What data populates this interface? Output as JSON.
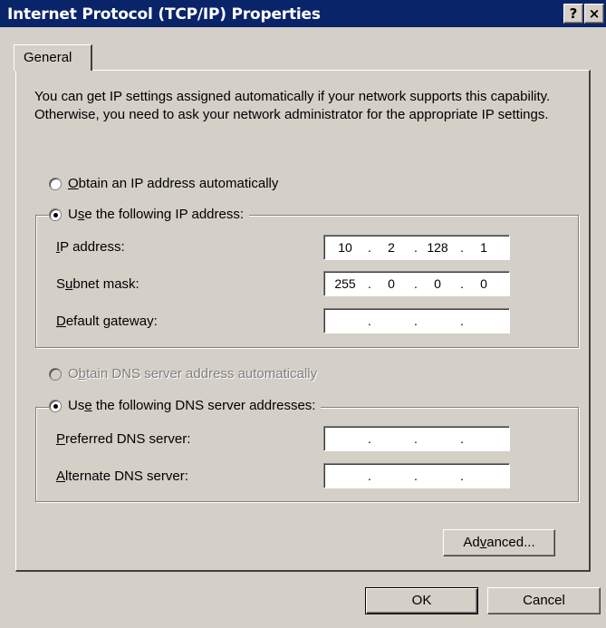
{
  "window": {
    "title": "Internet Protocol (TCP/IP) Properties",
    "help_label": "?",
    "close_label": "×"
  },
  "tab": {
    "label": "General"
  },
  "intro": "You can get IP settings assigned automatically if your network supports this capability. Otherwise, you need to ask your network administrator for the appropriate IP settings.",
  "ip_mode": {
    "auto": {
      "pre": "",
      "key": "O",
      "post": "btain an IP address automatically",
      "checked": false
    },
    "manual": {
      "pre": "U",
      "key": "s",
      "post": "e the following IP address:",
      "checked": true
    }
  },
  "ip_fields": {
    "ip_address": {
      "pre": "",
      "key": "I",
      "post": "P address:",
      "octets": [
        "10",
        "2",
        "128",
        "1"
      ]
    },
    "subnet_mask": {
      "pre": "S",
      "key": "u",
      "post": "bnet mask:",
      "octets": [
        "255",
        "0",
        "0",
        "0"
      ]
    },
    "default_gateway": {
      "pre": "",
      "key": "D",
      "post": "efault gateway:",
      "octets": [
        "",
        "",
        "",
        ""
      ]
    }
  },
  "dns_mode": {
    "auto": {
      "pre": "O",
      "key": "b",
      "post": "tain DNS server address automatically",
      "checked": false,
      "disabled": true
    },
    "manual": {
      "pre": "Us",
      "key": "e",
      "post": " the following DNS server addresses:",
      "checked": true
    }
  },
  "dns_fields": {
    "preferred": {
      "pre": "",
      "key": "P",
      "post": "referred DNS server:",
      "octets": [
        "",
        "",
        "",
        ""
      ]
    },
    "alternate": {
      "pre": "",
      "key": "A",
      "post": "lternate DNS server:",
      "octets": [
        "",
        "",
        "",
        ""
      ]
    }
  },
  "buttons": {
    "advanced": {
      "pre": "Ad",
      "key": "v",
      "post": "anced..."
    },
    "ok": "OK",
    "cancel": "Cancel"
  },
  "colors": {
    "titlebar": "#0a246a",
    "face": "#d4d0c8",
    "disabled_text": "#808080"
  }
}
